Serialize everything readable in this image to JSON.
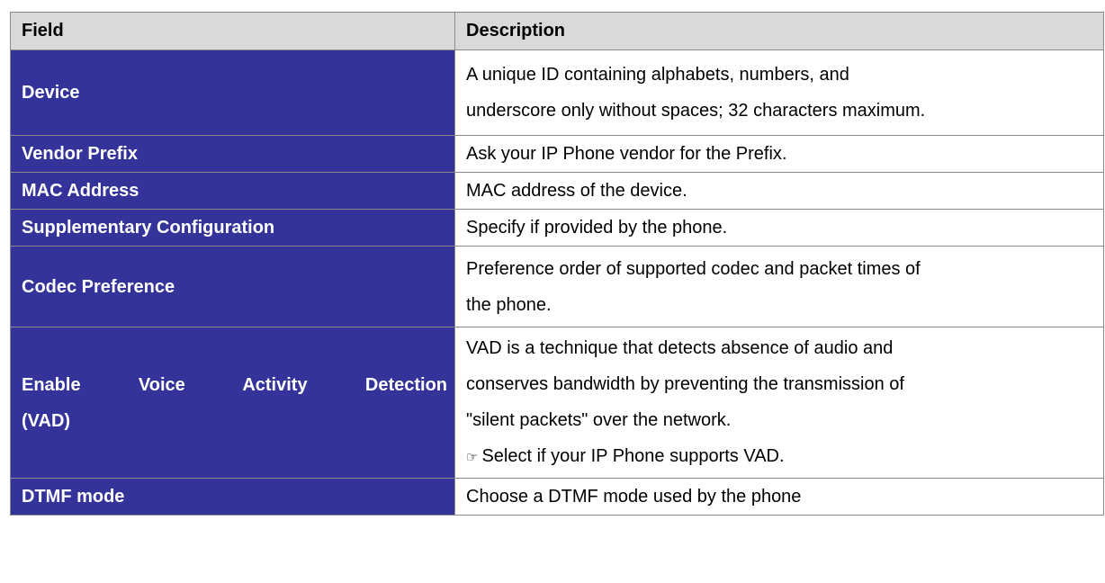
{
  "table": {
    "headers": {
      "field": "Field",
      "description": "Description"
    },
    "rows": [
      {
        "field": "Device",
        "description": [
          "A unique ID containing alphabets, numbers, and",
          "underscore only without spaces; 32 characters maximum."
        ]
      },
      {
        "field": "Vendor Prefix",
        "description": [
          "Ask your IP Phone vendor for the Prefix."
        ]
      },
      {
        "field": "MAC Address",
        "description": [
          "MAC address of the device."
        ]
      },
      {
        "field": "Supplementary Configuration",
        "description": [
          "Specify if provided by the phone."
        ]
      },
      {
        "field": "Codec Preference",
        "description": [
          "Preference order of supported codec and packet times of",
          "the phone."
        ]
      },
      {
        "field_lines": [
          "Enable Voice Activity Detection",
          "(VAD)"
        ],
        "description": [
          "VAD is a technique that detects absence of audio and",
          "conserves bandwidth by preventing the transmission of",
          "\"silent packets\" over the network."
        ],
        "note": "Select if your IP Phone supports VAD."
      },
      {
        "field": "DTMF mode",
        "description": [
          "Choose a DTMF mode used by the phone"
        ]
      }
    ]
  },
  "icons": {
    "note": "pointing-hand-icon"
  },
  "colors": {
    "header_bg": "#d9d9d9",
    "field_bg": "#333399",
    "field_text": "#ffffff",
    "border": "#8a8a8a"
  }
}
